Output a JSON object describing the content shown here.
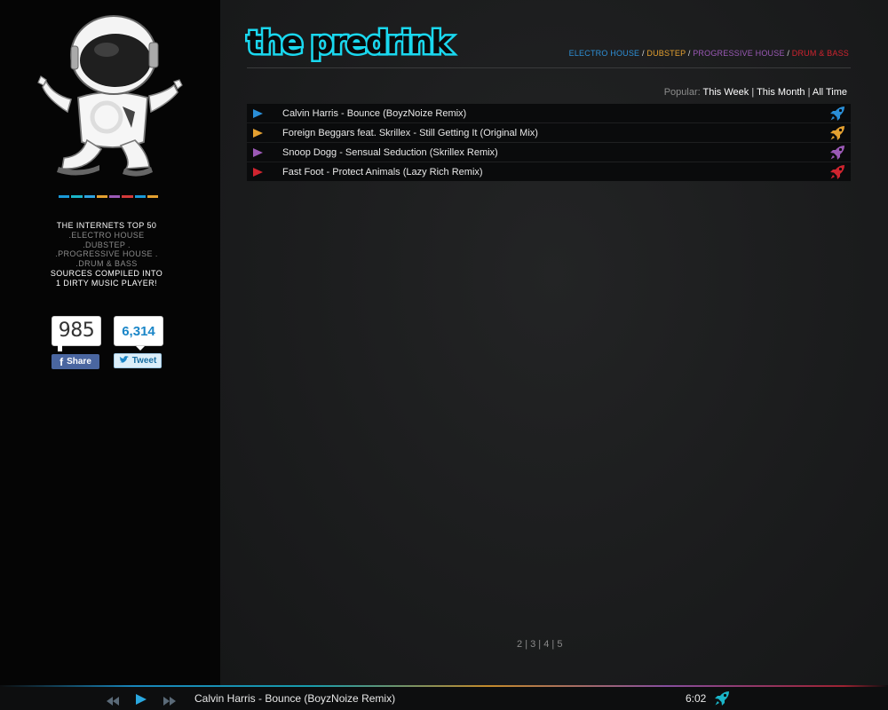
{
  "sidebar": {
    "color_bar": [
      "#1a9ad8",
      "#1ab5c8",
      "#2fa3e0",
      "#e4a030",
      "#9b59b6",
      "#d23a3a",
      "#1a9ad8",
      "#e4a030"
    ],
    "tagline": [
      {
        "text": "THE INTERNETS TOP 50",
        "style": "w"
      },
      {
        "text": ".ELECTRO HOUSE",
        "style": "g"
      },
      {
        "text": ".DUBSTEP .",
        "style": "g"
      },
      {
        "text": ".PROGRESSIVE HOUSE .",
        "style": "g"
      },
      {
        "text": ".DRUM & BASS",
        "style": "g"
      },
      {
        "text": "SOURCES COMPILED INTO",
        "style": "w"
      },
      {
        "text": "1 DIRTY MUSIC PLAYER!",
        "style": "w"
      }
    ],
    "facebook": {
      "count": "985",
      "label": "Share"
    },
    "twitter": {
      "count": "6,314",
      "label": "Tweet"
    }
  },
  "header": {
    "logo_text": "the predrink",
    "genres": [
      {
        "label": "ELECTRO HOUSE",
        "color": "#2e8fd6"
      },
      {
        "label": "DUBSTEP",
        "color": "#e4a030"
      },
      {
        "label": "PROGRESSIVE HOUSE",
        "color": "#9b59b6"
      },
      {
        "label": "DRUM & BASS",
        "color": "#d0242f"
      }
    ],
    "separator": "/"
  },
  "popular": {
    "label": "Popular:",
    "links": [
      "This Week",
      "This Month",
      "All Time"
    ],
    "separator": "|"
  },
  "tracks": [
    {
      "title": "Calvin Harris - Bounce (BoyzNoize Remix)",
      "color": "#2a8ed8"
    },
    {
      "title": "Foreign Beggars feat. Skrillex - Still Getting It (Original Mix)",
      "color": "#e4a030"
    },
    {
      "title": "Snoop Dogg - Sensual Seduction (Skrillex Remix)",
      "color": "#9b59b6"
    },
    {
      "title": "Fast Foot - Protect Animals (Lazy Rich Remix)",
      "color": "#d0242f"
    }
  ],
  "pagination": {
    "pages": [
      "2",
      "3",
      "4",
      "5"
    ],
    "separator": "|"
  },
  "player": {
    "now_playing": "Calvin Harris - Bounce (BoyzNoize Remix)",
    "time": "6:02",
    "accent": "#1ab5c8"
  }
}
